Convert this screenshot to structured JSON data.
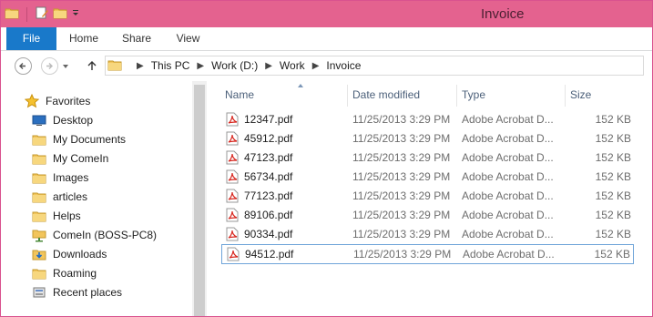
{
  "window": {
    "title": "Invoice",
    "accent_color": "#e4628f"
  },
  "quick_access": {
    "icons": [
      "folder-icon",
      "properties-icon",
      "new-folder-icon",
      "customize-dropdown-icon"
    ]
  },
  "ribbon": {
    "tabs": [
      {
        "label": "File",
        "active": true
      },
      {
        "label": "Home"
      },
      {
        "label": "Share"
      },
      {
        "label": "View"
      }
    ]
  },
  "address": {
    "crumbs": [
      "This PC",
      "Work (D:)",
      "Work",
      "Invoice"
    ]
  },
  "navigation": {
    "favorites_label": "Favorites",
    "items": [
      {
        "label": "Desktop",
        "icon": "desktop-icon"
      },
      {
        "label": "My Documents",
        "icon": "folder-icon"
      },
      {
        "label": "My ComeIn",
        "icon": "folder-icon"
      },
      {
        "label": "Images",
        "icon": "folder-icon"
      },
      {
        "label": "articles",
        "icon": "folder-icon"
      },
      {
        "label": "Helps",
        "icon": "folder-icon"
      },
      {
        "label": "ComeIn (BOSS-PC8)",
        "icon": "network-folder-icon"
      },
      {
        "label": "Downloads",
        "icon": "downloads-folder-icon"
      },
      {
        "label": "Roaming",
        "icon": "folder-icon"
      },
      {
        "label": "Recent places",
        "icon": "recent-places-icon"
      }
    ]
  },
  "file_list": {
    "columns": [
      "Name",
      "Date modified",
      "Type",
      "Size"
    ],
    "rows": [
      {
        "name": "12347.pdf",
        "date": "11/25/2013 3:29 PM",
        "type": "Adobe Acrobat D...",
        "size": "152 KB"
      },
      {
        "name": "45912.pdf",
        "date": "11/25/2013 3:29 PM",
        "type": "Adobe Acrobat D...",
        "size": "152 KB"
      },
      {
        "name": "47123.pdf",
        "date": "11/25/2013 3:29 PM",
        "type": "Adobe Acrobat D...",
        "size": "152 KB"
      },
      {
        "name": "56734.pdf",
        "date": "11/25/2013 3:29 PM",
        "type": "Adobe Acrobat D...",
        "size": "152 KB"
      },
      {
        "name": "77123.pdf",
        "date": "11/25/2013 3:29 PM",
        "type": "Adobe Acrobat D...",
        "size": "152 KB"
      },
      {
        "name": "89106.pdf",
        "date": "11/25/2013 3:29 PM",
        "type": "Adobe Acrobat D...",
        "size": "152 KB"
      },
      {
        "name": "90334.pdf",
        "date": "11/25/2013 3:29 PM",
        "type": "Adobe Acrobat D...",
        "size": "152 KB"
      },
      {
        "name": "94512.pdf",
        "date": "11/25/2013 3:29 PM",
        "type": "Adobe Acrobat D...",
        "size": "152 KB",
        "selected": true
      }
    ]
  }
}
